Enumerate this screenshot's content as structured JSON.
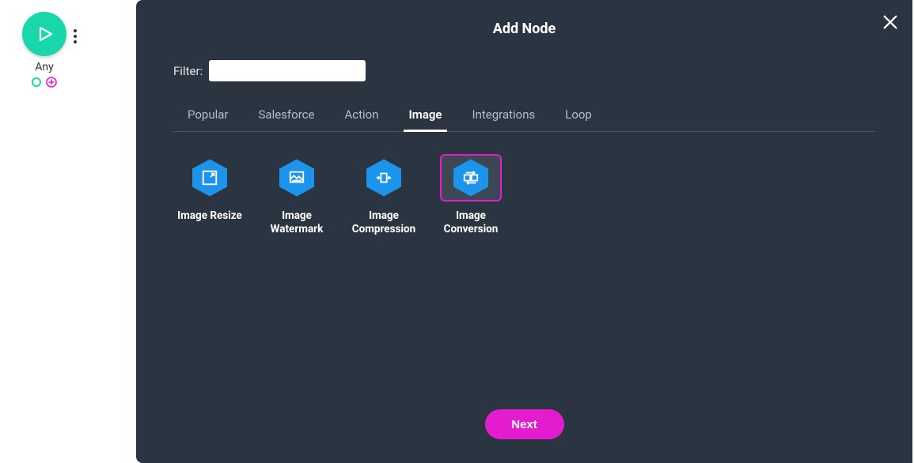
{
  "canvas": {
    "start_node_label": "Any"
  },
  "modal": {
    "title": "Add Node",
    "filter_label": "Filter:",
    "filter_value": "",
    "tabs": [
      {
        "label": "Popular"
      },
      {
        "label": "Salesforce"
      },
      {
        "label": "Action"
      },
      {
        "label": "Image"
      },
      {
        "label": "Integrations"
      },
      {
        "label": "Loop"
      }
    ],
    "active_tab_index": 3,
    "options": [
      {
        "label": "Image Resize",
        "icon": "resize-icon"
      },
      {
        "label": "Image Watermark",
        "icon": "watermark-icon"
      },
      {
        "label": "Image Compression",
        "icon": "compression-icon"
      },
      {
        "label": "Image Conversion",
        "icon": "conversion-icon"
      }
    ],
    "selected_option_index": 3,
    "next_label": "Next"
  },
  "colors": {
    "modal_bg": "#2b3542",
    "accent_teal": "#18d7aa",
    "accent_pink": "#e31ccf",
    "hex_blue": "#1c94eb"
  }
}
